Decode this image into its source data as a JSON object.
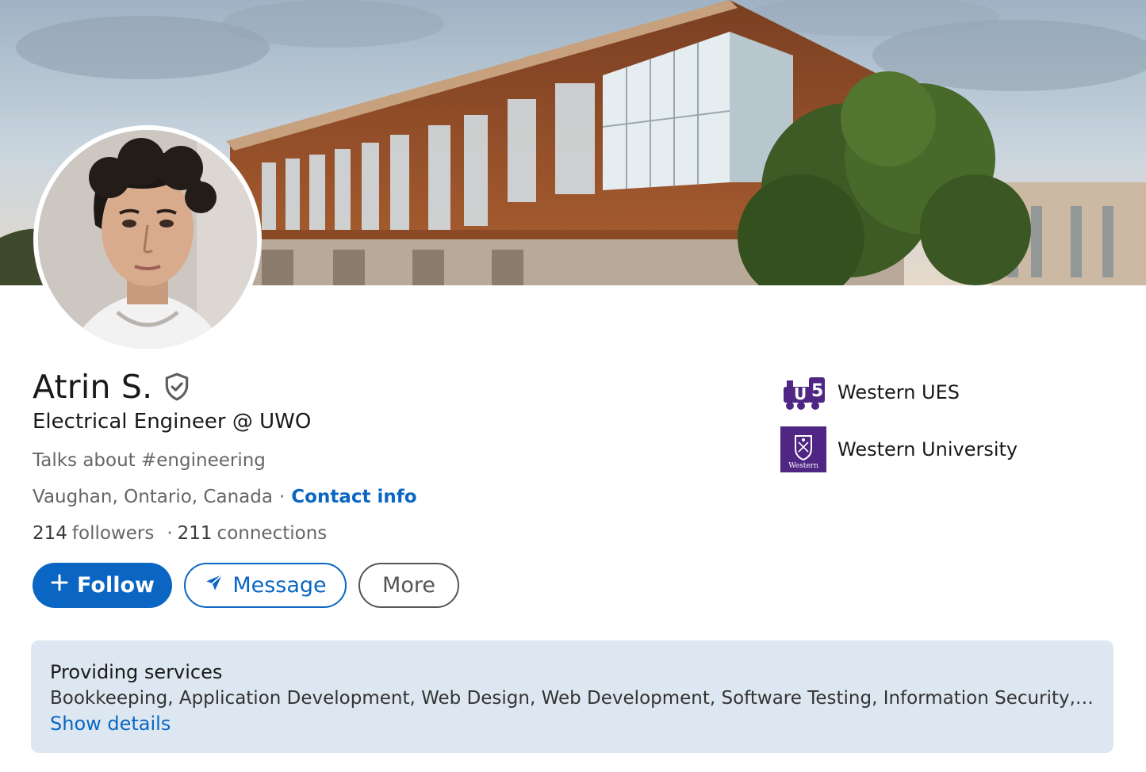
{
  "profile": {
    "name": "Atrin S.",
    "headline": "Electrical Engineer @ UWO",
    "talks_about": "Talks about #engineering",
    "location": "Vaughan, Ontario, Canada",
    "location_separator": "·",
    "contact_label": "Contact info",
    "followers_count": "214",
    "followers_label": "followers",
    "stats_separator": "·",
    "connections_count": "211",
    "connections_label": "connections"
  },
  "actions": {
    "follow_label": "Follow",
    "message_label": "Message",
    "more_label": "More"
  },
  "organizations": [
    {
      "name": "Western UES",
      "logo": "ues-train-logo"
    },
    {
      "name": "Western University",
      "logo": "western-crest-logo"
    }
  ],
  "services": {
    "title": "Providing services",
    "list": "Bookkeeping, Application Development, Web Design, Web Development, Software Testing, Information Security, Info...",
    "link": "Show details"
  },
  "colors": {
    "accent": "#0a66c2",
    "western_purple": "#4f2683",
    "services_bg": "#dde7f1"
  },
  "logos": {
    "western_crest_text": "Western"
  }
}
